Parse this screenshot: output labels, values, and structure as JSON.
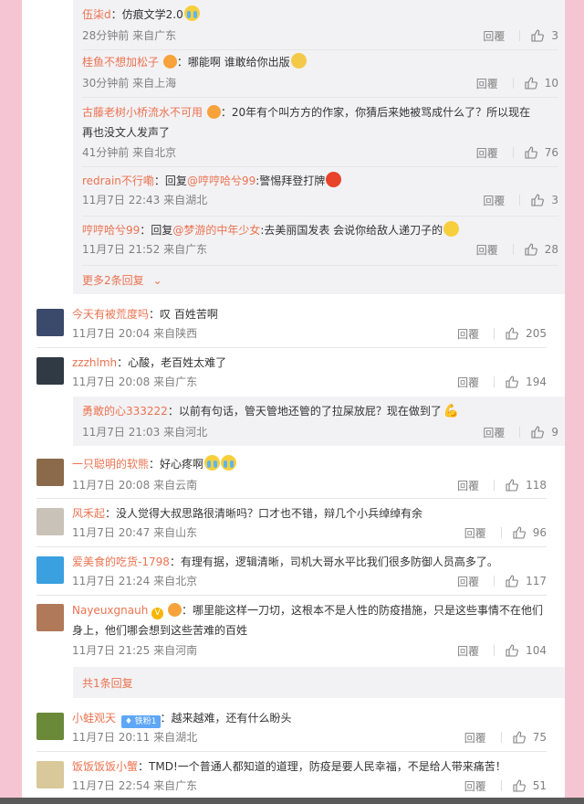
{
  "reply_label": "回覆",
  "sub_top": [
    {
      "user": "伍柒d",
      "sep": "：",
      "text": "仿痕文学2.0",
      "emoji": "cry",
      "meta": "28分钟前 来自广东",
      "likes": "3"
    },
    {
      "user": "桂鱼不想加松子",
      "badge": "heart",
      "sep": "：",
      "text": "哪能啊 谁敢给你出版",
      "emoji": "wink",
      "meta": "30分钟前 来自上海",
      "likes": "10"
    },
    {
      "user": "古藤老树小桥流水不可用",
      "badge": "heart",
      "sep": "：",
      "text": "20年有个叫方方的作家，你猜后来她被骂成什么了？所以现在再也没文人发声了",
      "meta": "41分钟前 来自北京",
      "likes": "76"
    },
    {
      "user": "redrain不行嘞",
      "sep": "：",
      "prefix": "回复",
      "mention": "@哼哼哈兮99",
      "text": ":警惕拜登打牌",
      "emoji": "angry",
      "meta": "11月7日 22:43 来自湖北",
      "likes": "3"
    },
    {
      "user": "哼哼哈兮99",
      "sep": "：",
      "prefix": "回复",
      "mention": "@梦游的中年少女",
      "text": ":去美丽国发表 会说你给敌人递刀子的",
      "emoji": "scared",
      "meta": "11月7日 21:52 来自广东",
      "likes": "28"
    }
  ],
  "more_replies": "更多2条回复",
  "comments": [
    {
      "user": "今天有被荒度吗",
      "sep": "：",
      "text": "叹 百姓苦啊",
      "meta": "11月7日 20:04 来自陕西",
      "likes": "205",
      "avatar": "#3b4a6b"
    },
    {
      "user": "zzzhlmh",
      "sep": "：",
      "text": "心酸，老百姓太难了",
      "meta": "11月7日 20:08 来自广东",
      "likes": "194",
      "avatar": "#2f3a44"
    },
    {
      "user": "一只聪明的软熊",
      "sep": "：",
      "text": "好心疼啊",
      "emoji": "cry",
      "emoji2": "cry",
      "meta": "11月7日 20:08 来自云南",
      "likes": "118",
      "avatar": "#8a6a4a"
    },
    {
      "user": "风禾起",
      "sep": "：",
      "text": "没人觉得大叔思路很清晰吗？口才也不错，辩几个小兵绰绰有余",
      "meta": "11月7日 20:47 来自山东",
      "likes": "96",
      "avatar": "#c9c2b8"
    },
    {
      "user": "爱美食的吃货-1798",
      "sep": "：",
      "text": "有理有据，逻辑清晰，司机大哥水平比我们很多防御人员高多了。",
      "meta": "11月7日 21:24 来自北京",
      "likes": "117",
      "avatar": "#3aa0e0"
    },
    {
      "user": "Nayeuxgnauh",
      "badge": "v",
      "sep": "：",
      "text": "哪里能这样一刀切，这根本不是人性的防疫措施，只是这些事情不在他们身上，他们哪会想到这些苦难的百姓",
      "meta": "11月7日 21:25 来自河南",
      "likes": "104",
      "avatar": "#b07a5a"
    },
    {
      "user": "小蛙观天",
      "badge": "lvl",
      "badge_text": "铁粉1",
      "sep": "：",
      "text": "越来越难，还有什么盼头",
      "meta": "11月7日 20:11 来自湖北",
      "likes": "75",
      "avatar": "#6a8a3a"
    },
    {
      "user": "饭饭饭饭小蟹",
      "sep": "：",
      "text": "TMD!一个普通人都知道的道理，防疫是要人民幸福，不是给人带来痛苦！",
      "meta": "11月7日 22:54 来自广东",
      "likes": "51",
      "avatar": "#d8c89a"
    }
  ],
  "sub_mid": {
    "user": "勇敢的心333222",
    "sep": "：",
    "text": "以前有句话，管天管地还管的了拉屎放屁？现在做到了",
    "emoji": "arm",
    "meta": "11月7日 21:03 来自河北",
    "likes": "9"
  },
  "total_replies": "共1条回复"
}
